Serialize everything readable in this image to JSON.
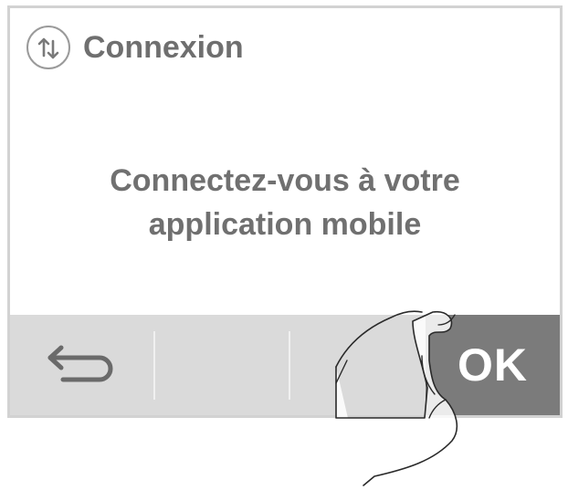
{
  "header": {
    "icon": "sync-arrows-icon",
    "title": "Connexion"
  },
  "message": {
    "line1": "Connectez-vous à votre",
    "line2": "application mobile"
  },
  "bottom_bar": {
    "back_icon": "back-arrow-icon",
    "ok_label": "OK"
  },
  "colors": {
    "border": "#d2d2d2",
    "text": "#707070",
    "bar_bg": "#dadada",
    "ok_bg": "#7b7b7b"
  }
}
